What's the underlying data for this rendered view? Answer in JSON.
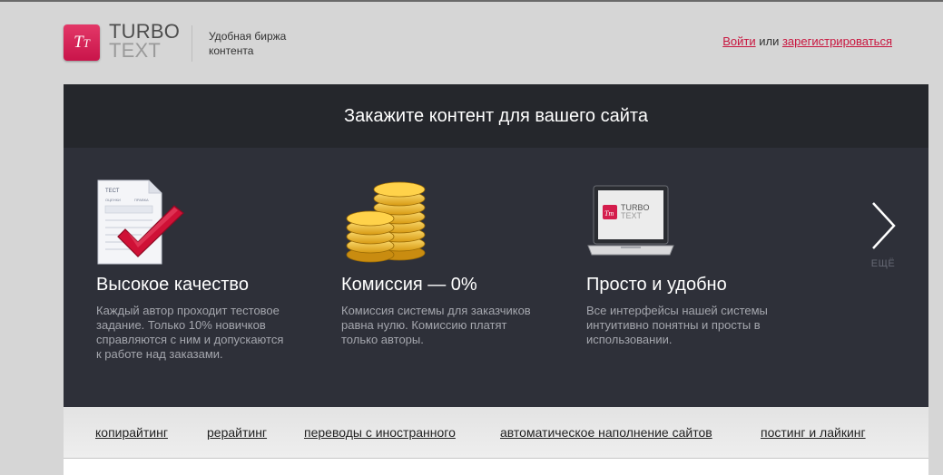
{
  "header": {
    "logo": {
      "mark": "T",
      "mark_small": "T",
      "line1": "TURBO",
      "line2": "TEXT"
    },
    "tagline": [
      "Удобная биржа",
      "контента"
    ],
    "auth": {
      "login": "Войти",
      "or": "или",
      "register": "зарегистрироваться"
    }
  },
  "hero": {
    "title": "Закажите контент для вашего сайта",
    "features": [
      {
        "icon": "document-check-icon",
        "title": "Высокое качество",
        "text": [
          "Каждый автор проходит тестовое",
          "задание. Только 10% новичков",
          "справляются с ним и допускаются",
          "к работе над заказами."
        ],
        "doc_labels": {
          "heading": "ТЕСТ",
          "col1": "ОЦЕНКИ",
          "col2": "ПРАВКА"
        }
      },
      {
        "icon": "coins-icon",
        "title": "Комиссия — 0%",
        "text": [
          "Комиссия системы для заказчиков",
          "равна нулю. Комиссию платят",
          "только авторы."
        ]
      },
      {
        "icon": "laptop-icon",
        "title": "Просто и удобно",
        "text": [
          "Все интерфейсы нашей системы",
          "интуитивно понятны и просты в",
          "использовании."
        ],
        "screen_logo": {
          "mark": "Tт",
          "line1": "TURBO",
          "line2": "TEXT"
        }
      }
    ],
    "next": {
      "icon": "chevron-right-icon",
      "label": "ЕЩЁ"
    }
  },
  "tags": [
    "копирайтинг",
    "рерайтинг",
    "переводы с иностранного",
    "автоматическое наполнение сайтов",
    "постинг и лайкинг"
  ],
  "colors": {
    "accent": "#c8163f",
    "hero_bg": "#2e3039",
    "hero_title_bg": "#25272c",
    "page_bg": "#d6d6d6"
  }
}
